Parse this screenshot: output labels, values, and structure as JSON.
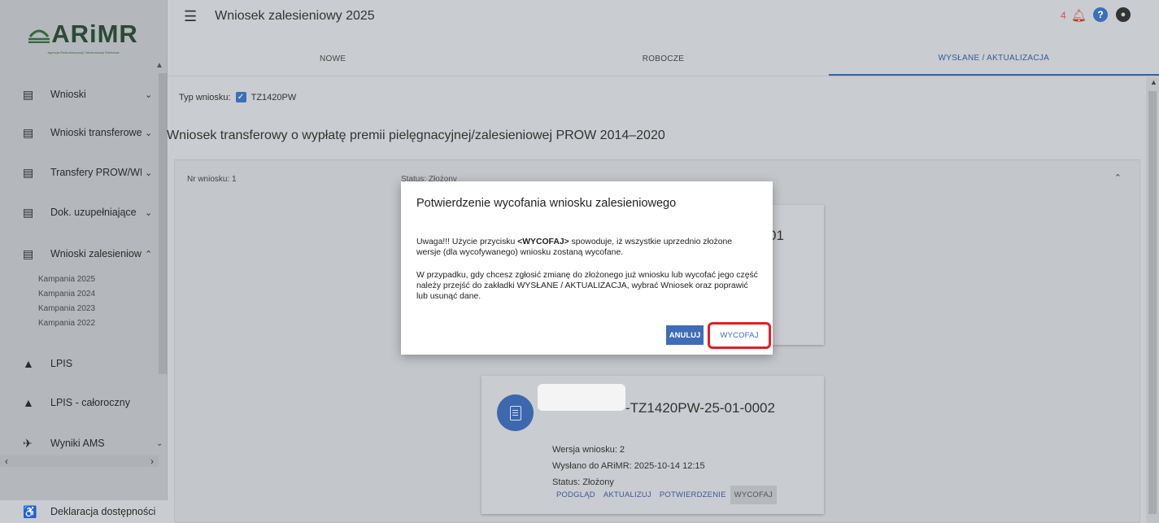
{
  "logo": {
    "text": "ARiMR",
    "subtitle": "Agencja Restrukturyzacji i Modernizacji Rolnictwa"
  },
  "sidebar": {
    "items": [
      {
        "label": "Wnioski",
        "icon": "clipboard-icon",
        "expandable": true
      },
      {
        "label": "Wnioski transferowe",
        "icon": "clipboard-icon",
        "expandable": true
      },
      {
        "label": "Transfery PROW/WPR",
        "icon": "clipboard-icon",
        "expandable": true
      },
      {
        "label": "Dok. uzupełniające",
        "icon": "clipboard-icon",
        "expandable": true
      },
      {
        "label": "Wnioski zalesieniowe",
        "icon": "clipboard-icon",
        "expandable": true
      },
      {
        "label": "LPIS",
        "icon": "mountain-icon",
        "expandable": false
      },
      {
        "label": "LPIS - całoroczny",
        "icon": "mountain-icon",
        "expandable": false
      },
      {
        "label": "Wyniki AMS",
        "icon": "satellite-icon",
        "expandable": false
      }
    ],
    "subitems": [
      "Kampania 2025",
      "Kampania 2024",
      "Kampania 2023",
      "Kampania 2022"
    ],
    "footer": {
      "label": "Deklaracja dostępności",
      "icon": "accessibility-icon"
    }
  },
  "header": {
    "title": "Wniosek zalesieniowy 2025",
    "notification_count": "4"
  },
  "tabs": [
    {
      "label": "NOWE",
      "active": false
    },
    {
      "label": "ROBOCZE",
      "active": false
    },
    {
      "label": "WYSŁANE / AKTUALIZACJA",
      "active": true
    }
  ],
  "filter": {
    "label": "Typ wniosku:",
    "checkbox_value": "TZ1420PW",
    "checked": true
  },
  "main": {
    "title": "Wniosek transferowy o wypłatę premii pielęgnacyjnej/zalesieniowej PROW 2014–2020",
    "panel": {
      "nr_label": "Nr wniosku: 1",
      "status_label": "Status: Złożony"
    },
    "card1": {
      "number_fragment": "01"
    },
    "card2": {
      "number": "-TZ1420PW-25-01-0002",
      "version": "Wersja wniosku: 2",
      "sent": "Wysłano do ARiMR: 2025-10-14 12:15",
      "status": "Status: Złożony",
      "actions": [
        "PODGLĄD",
        "AKTUALIZUJ",
        "POTWIERDZENIE",
        "WYCOFAJ"
      ]
    }
  },
  "dialog": {
    "title": "Potwierdzenie wycofania wniosku zalesieniowego",
    "p1_prefix": "Uwaga!!! Użycie przycisku ",
    "p1_strong": "<WYCOFAJ>",
    "p1_suffix": " spowoduje, iż wszystkie uprzednio złożone wersje (dla wycofywanego) wniosku zostaną wycofane.",
    "p2": "W przypadku, gdy chcesz zgłosić zmianę do złożonego już wniosku lub wycofać jego część należy przejść do zakładki WYSŁANE / AKTUALIZACJA, wybrać Wniosek oraz poprawić lub usunąć dane.",
    "cancel_label": "ANULUJ",
    "confirm_label": "WYCOFAJ"
  },
  "colors": {
    "accent": "#3f6cb7",
    "highlight": "#e02020",
    "overlay": "#c9ccd0"
  }
}
